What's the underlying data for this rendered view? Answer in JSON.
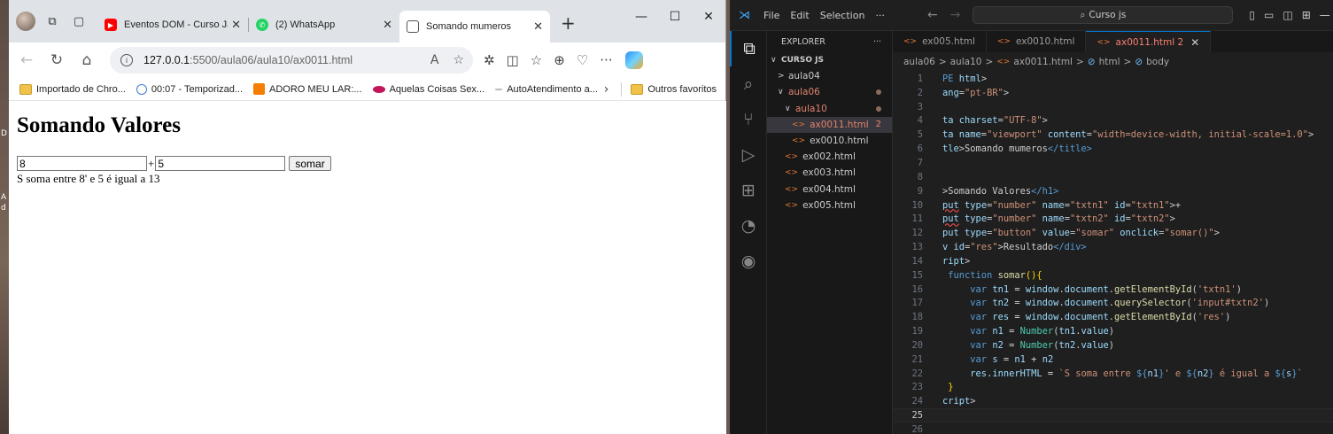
{
  "browser": {
    "tabs": [
      {
        "title": "Eventos DOM - Curso JavaS",
        "favicon": "youtube-icon",
        "color": "#ff0000"
      },
      {
        "title": "(2) WhatsApp",
        "favicon": "whatsapp-icon",
        "color": "#25d366"
      },
      {
        "title": "Somando mumeros",
        "favicon": "page-icon",
        "color": "#555555",
        "active": true
      }
    ],
    "url_host": "127.0.0.1",
    "url_path": ":5500/aula06/aula10/ax0011.html",
    "bookmarks": [
      {
        "label": "Importado de Chro...",
        "icon": "folder-icon"
      },
      {
        "label": "00:07 - Temporizad...",
        "icon": "clock-icon"
      },
      {
        "label": "ADORO MEU LAR:...",
        "icon": "blogger-icon"
      },
      {
        "label": "Aquelas Coisas Sex...",
        "icon": "lips-icon"
      },
      {
        "label": "AutoAtendimento a...",
        "icon": "dash-icon"
      }
    ],
    "other_favorites": "Outros favoritos",
    "page": {
      "heading": "Somando Valores",
      "input1_value": "8",
      "plus": "+",
      "input2_value": "5",
      "button_label": "somar",
      "result": "S soma entre 8' e 5 é igual a 13"
    }
  },
  "desktop_labels": [
    "D",
    "A",
    "d"
  ],
  "vscode": {
    "menu": [
      "File",
      "Edit",
      "Selection",
      "···"
    ],
    "search_label": "Curso js",
    "explorer_title": "EXPLORER",
    "explorer_more": "···",
    "tree": [
      {
        "label": "CURSO JS",
        "indent": 0,
        "chevron": "∨",
        "bold": true
      },
      {
        "label": "aula04",
        "indent": 1,
        "chevron": ">"
      },
      {
        "label": "aula06",
        "indent": 1,
        "chevron": "∨",
        "modified": true
      },
      {
        "label": "aula10",
        "indent": 2,
        "chevron": "∨",
        "modified": true
      },
      {
        "label": "ax0011.html",
        "indent": 3,
        "file": true,
        "modified": true,
        "badge": "2",
        "selected": true
      },
      {
        "label": "ex0010.html",
        "indent": 3,
        "file": true
      },
      {
        "label": "ex002.html",
        "indent": 2,
        "file": true
      },
      {
        "label": "ex003.html",
        "indent": 2,
        "file": true
      },
      {
        "label": "ex004.html",
        "indent": 2,
        "file": true
      },
      {
        "label": "ex005.html",
        "indent": 2,
        "file": true
      }
    ],
    "editor_tabs": [
      {
        "label": "ex005.html"
      },
      {
        "label": "ex0010.html"
      },
      {
        "label": "ax0011.html 2",
        "active": true
      }
    ],
    "breadcrumbs": [
      "aula06",
      ">",
      "aula10",
      ">",
      "ax0011.html",
      ">",
      "html",
      ">",
      "body"
    ],
    "code_lines": [
      {
        "n": "1",
        "html": "<span class='tg'>PE</span> <span class='at'>html</span><span class='t'>></span>"
      },
      {
        "n": "2",
        "html": "<span class='at'>ang</span><span class='t'>=</span><span class='st'>\"pt-BR\"</span><span class='t'>></span>"
      },
      {
        "n": "3",
        "html": ""
      },
      {
        "n": "4",
        "html": "<span class='at'>ta charset</span><span class='t'>=</span><span class='st'>\"UTF-8\"</span><span class='t'>></span>"
      },
      {
        "n": "5",
        "html": "<span class='at'>ta name</span><span class='t'>=</span><span class='st'>\"viewport\"</span> <span class='at'>content</span><span class='t'>=</span><span class='st'>\"width=device-width, initial-scale=1.0\"</span><span class='t'>></span>"
      },
      {
        "n": "6",
        "html": "<span class='at'>tle</span><span class='t'>>Somando mumeros</span><span class='tg'>&lt;/title&gt;</span>"
      },
      {
        "n": "7",
        "html": ""
      },
      {
        "n": "8",
        "html": ""
      },
      {
        "n": "9",
        "html": "<span class='t'>>Somando Valores</span><span class='tg'>&lt;/h1&gt;</span>"
      },
      {
        "n": "10",
        "html": "<span class='at sq'>put</span> <span class='at'>type</span><span class='t'>=</span><span class='st'>\"number\"</span> <span class='at'>name</span><span class='t'>=</span><span class='st'>\"txtn1\"</span> <span class='at'>id</span><span class='t'>=</span><span class='st'>\"txtn1\"</span><span class='t'>>+</span>"
      },
      {
        "n": "11",
        "html": "<span class='at sq'>put</span> <span class='at'>type</span><span class='t'>=</span><span class='st'>\"number\"</span> <span class='at'>name</span><span class='t'>=</span><span class='st'>\"txtn2\"</span> <span class='at'>id</span><span class='t'>=</span><span class='st'>\"txtn2\"</span><span class='t'>></span>"
      },
      {
        "n": "12",
        "html": "<span class='at'>put</span> <span class='at'>type</span><span class='t'>=</span><span class='st'>\"button\"</span> <span class='at'>value</span><span class='t'>=</span><span class='st'>\"somar\"</span> <span class='at'>onclick</span><span class='t'>=</span><span class='st'>\"somar()\"</span><span class='t'>></span>"
      },
      {
        "n": "13",
        "html": "<span class='at'>v id</span><span class='t'>=</span><span class='st'>\"res\"</span><span class='t'>>Resultado</span><span class='tg'>&lt;/div&gt;</span>"
      },
      {
        "n": "14",
        "html": "<span class='at'>ript</span><span class='t'>></span>"
      },
      {
        "n": "15",
        "html": " <span class='kw'>function</span> <span class='fn'>somar</span><span class='br'>()</span><span class='br'>{</span>"
      },
      {
        "n": "16",
        "html": "     <span class='kw'>var</span> <span class='vr'>tn1</span> <span class='op'>=</span> <span class='vr'>window</span><span class='t'>.</span><span class='vr'>document</span><span class='t'>.</span><span class='fn'>getElementById</span><span class='t'>(</span><span class='st'>'txtn1'</span><span class='t'>)</span>"
      },
      {
        "n": "17",
        "html": "     <span class='kw'>var</span> <span class='vr'>tn2</span> <span class='op'>=</span> <span class='vr'>window</span><span class='t'>.</span><span class='vr'>document</span><span class='t'>.</span><span class='fn'>querySelector</span><span class='t'>(</span><span class='st'>'input#txtn2'</span><span class='t'>)</span>"
      },
      {
        "n": "18",
        "html": "     <span class='kw'>var</span> <span class='vr'>res</span> <span class='op'>=</span> <span class='vr'>window</span><span class='t'>.</span><span class='vr'>document</span><span class='t'>.</span><span class='fn'>getElementById</span><span class='t'>(</span><span class='st'>'res'</span><span class='t'>)</span>"
      },
      {
        "n": "19",
        "html": "     <span class='kw'>var</span> <span class='vr'>n1</span> <span class='op'>=</span> <span class='cl'>Number</span><span class='t'>(</span><span class='vr'>tn1</span><span class='t'>.</span><span class='vr'>value</span><span class='t'>)</span>"
      },
      {
        "n": "20",
        "html": "     <span class='kw'>var</span> <span class='vr'>n2</span> <span class='op'>=</span> <span class='cl'>Number</span><span class='t'>(</span><span class='vr'>tn2</span><span class='t'>.</span><span class='vr'>value</span><span class='t'>)</span>"
      },
      {
        "n": "21",
        "html": "     <span class='kw'>var</span> <span class='vr'>s</span> <span class='op'>=</span> <span class='vr'>n1</span> <span class='op'>+</span> <span class='vr'>n2</span>"
      },
      {
        "n": "22",
        "html": "     <span class='vr'>res</span><span class='t'>.</span><span class='vr'>innerHTML</span> <span class='op'>=</span> <span class='st'>`S soma entre </span><span class='kw'>${</span><span class='vr'>n1</span><span class='kw'>}</span><span class='st'>' e </span><span class='kw'>${</span><span class='vr'>n2</span><span class='kw'>}</span><span class='st'> é igual a </span><span class='kw'>${</span><span class='vr'>s</span><span class='kw'>}</span><span class='st'>`</span>"
      },
      {
        "n": "23",
        "html": " <span class='br'>}</span>"
      },
      {
        "n": "24",
        "html": "<span class='at'>cript</span><span class='t'>></span>"
      },
      {
        "n": "25",
        "html": "",
        "current": true
      },
      {
        "n": "26",
        "html": ""
      }
    ]
  }
}
